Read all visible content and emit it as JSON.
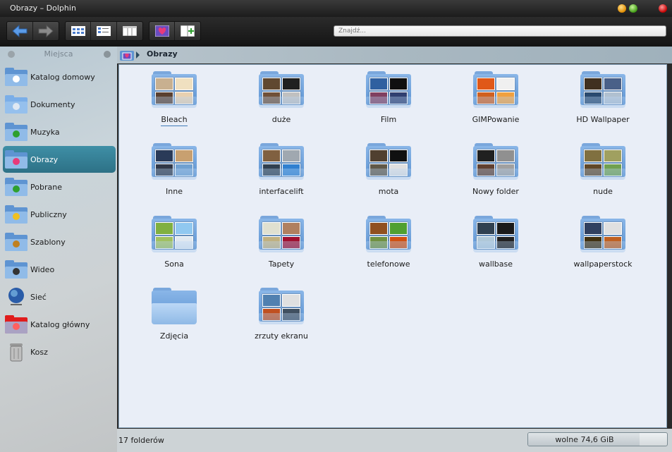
{
  "window": {
    "title": "Obrazy – Dolphin"
  },
  "toolbar": {
    "search_placeholder": "Znajdź..."
  },
  "sidebar": {
    "header": "Miejsca",
    "items": [
      {
        "label": "Katalog domowy",
        "icon": "home-folder-icon"
      },
      {
        "label": "Dokumenty",
        "icon": "documents-folder-icon"
      },
      {
        "label": "Muzyka",
        "icon": "music-folder-icon"
      },
      {
        "label": "Obrazy",
        "icon": "pictures-folder-icon",
        "active": true
      },
      {
        "label": "Pobrane",
        "icon": "downloads-folder-icon"
      },
      {
        "label": "Publiczny",
        "icon": "public-folder-icon"
      },
      {
        "label": "Szablony",
        "icon": "templates-folder-icon"
      },
      {
        "label": "Wideo",
        "icon": "video-folder-icon"
      },
      {
        "label": "Sieć",
        "icon": "network-icon"
      },
      {
        "label": "Katalog główny",
        "icon": "root-folder-icon"
      },
      {
        "label": "Kosz",
        "icon": "trash-icon"
      }
    ]
  },
  "breadcrumb": {
    "current": "Obrazy"
  },
  "files": [
    {
      "name": "Bleach",
      "selected": true
    },
    {
      "name": "duże"
    },
    {
      "name": "Film"
    },
    {
      "name": "GIMPowanie"
    },
    {
      "name": "HD Wallpaper"
    },
    {
      "name": "Inne"
    },
    {
      "name": "interfacelift"
    },
    {
      "name": "mota"
    },
    {
      "name": "Nowy folder"
    },
    {
      "name": "nude"
    },
    {
      "name": "Sona"
    },
    {
      "name": "Tapety"
    },
    {
      "name": "telefonowe"
    },
    {
      "name": "wallbase"
    },
    {
      "name": "wallpaperstock"
    },
    {
      "name": "Zdjęcia",
      "empty": true
    },
    {
      "name": "zrzuty ekranu"
    }
  ],
  "status": {
    "count": "17 folderów",
    "free_space": "wolne 74,6 GiB",
    "used_fraction": 0.8
  },
  "colors": {
    "accent": "#3f8fa6",
    "view_bg": "#e9eef7"
  }
}
